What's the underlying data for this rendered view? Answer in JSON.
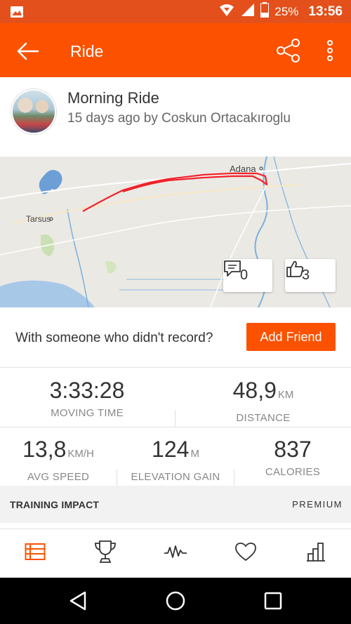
{
  "status_bar": {
    "battery": "25%",
    "time": "13:56",
    "icons": [
      "image-icon",
      "signal-hotspot-icon",
      "cell-signal-icon",
      "battery-icon"
    ]
  },
  "app_bar": {
    "title": "Ride",
    "icons": [
      "back-arrow-icon",
      "share-icon",
      "more-vert-icon"
    ]
  },
  "activity": {
    "title": "Morning Ride",
    "subtitle": "15 days ago by Coskun Ortacakıroglu"
  },
  "map": {
    "labels": {
      "city_right": "Adana",
      "city_left": "Tarsus"
    },
    "route_color": "#f0222a",
    "comments_count": "0",
    "kudos_count": "3"
  },
  "friend": {
    "prompt": "With someone who didn't record?",
    "button": "Add Friend"
  },
  "stats": {
    "moving_time": {
      "value": "3:33:28",
      "label": "MOVING TIME"
    },
    "distance": {
      "value": "48,9",
      "unit": "KM",
      "label": "DISTANCE"
    },
    "avg_speed": {
      "value": "13,8",
      "unit": "KM/H",
      "label": "AVG SPEED"
    },
    "elevation": {
      "value": "124",
      "unit": "M",
      "label": "ELEVATION GAIN"
    },
    "calories": {
      "value": "837",
      "label": "CALORIES"
    }
  },
  "training": {
    "title": "TRAINING IMPACT",
    "premium": "PREMIUM"
  },
  "tabs": [
    {
      "icon": "feed-icon",
      "active": true
    },
    {
      "icon": "trophy-icon",
      "active": false
    },
    {
      "icon": "activity-pulse-icon",
      "active": false
    },
    {
      "icon": "heart-icon",
      "active": false
    },
    {
      "icon": "bar-chart-icon",
      "active": false
    }
  ],
  "colors": {
    "brand": "#fc5200",
    "status_bar": "#e3501c",
    "active_tab": "#fc5200"
  }
}
